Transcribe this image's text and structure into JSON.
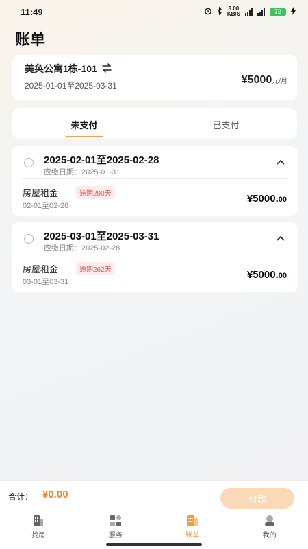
{
  "status_bar": {
    "time": "11:49",
    "net_speed_top": "8.00",
    "net_speed_bottom": "KB/S",
    "battery": "72"
  },
  "page_title": "账单",
  "apartment": {
    "name": "美奂公寓1栋-101",
    "date_range": "2025-01-01至2025-03-31",
    "price": "¥5000",
    "price_unit": "元/月"
  },
  "tabs": [
    {
      "label": "未支付",
      "active": true
    },
    {
      "label": "已支付",
      "active": false
    }
  ],
  "bills": [
    {
      "period": "2025-02-01至2025-02-28",
      "due_date": "应缴日期：2025-01-31",
      "item_name": "房屋租金",
      "overdue": "逾期290天",
      "item_range": "02-01至02-28",
      "amount_main": "¥5000.",
      "amount_cents": "00"
    },
    {
      "period": "2025-03-01至2025-03-31",
      "due_date": "应缴日期：2025-02-28",
      "item_name": "房屋租金",
      "overdue": "逾期262天",
      "item_range": "03-01至03-31",
      "amount_main": "¥5000.",
      "amount_cents": "00"
    }
  ],
  "total": {
    "label": "合计：",
    "value": "¥0.00",
    "pay_label": "付款"
  },
  "nav": [
    {
      "label": "找房",
      "icon": "building-icon",
      "active": false
    },
    {
      "label": "服务",
      "icon": "grid-icon",
      "active": false
    },
    {
      "label": "账单",
      "icon": "bill-icon",
      "active": true
    },
    {
      "label": "我的",
      "icon": "profile-icon",
      "active": false
    }
  ],
  "colors": {
    "accent": "#f39a3a",
    "overdue_text": "#e45858",
    "pay_button": "#fcd9b6"
  }
}
